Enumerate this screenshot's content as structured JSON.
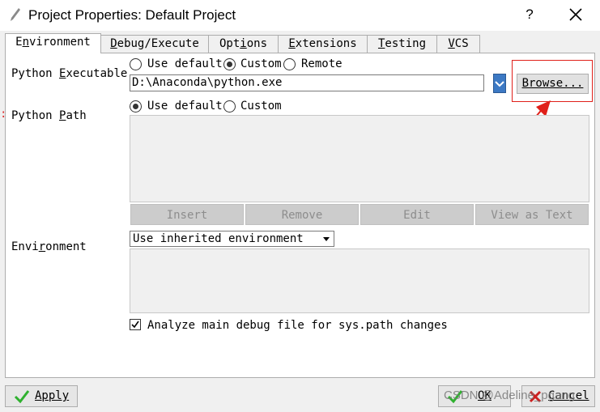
{
  "window": {
    "title": "Project Properties: Default Project",
    "help_label": "?",
    "close_icon": "close-icon",
    "title_icon": "pencil-icon"
  },
  "tabs": [
    {
      "label_pre": "E",
      "label_u": "n",
      "label_post": "vironment",
      "active": true
    },
    {
      "label_pre": "",
      "label_u": "D",
      "label_post": "ebug/Execute",
      "active": false
    },
    {
      "label_pre": "Opt",
      "label_u": "i",
      "label_post": "ons",
      "active": false
    },
    {
      "label_pre": "",
      "label_u": "E",
      "label_post": "xtensions",
      "active": false
    },
    {
      "label_pre": "",
      "label_u": "T",
      "label_post": "esting",
      "active": false
    },
    {
      "label_pre": "",
      "label_u": "V",
      "label_post": "CS",
      "active": false
    }
  ],
  "python_executable": {
    "label_pre": "Python ",
    "label_u": "E",
    "label_post": "xecutable",
    "options": [
      "Use default",
      "Custom",
      "Remote"
    ],
    "selected": "Custom",
    "value": "D:\\Anaconda\\python.exe",
    "browse_label": "Browse..."
  },
  "python_path": {
    "label_pre": "Python ",
    "label_u": "P",
    "label_post": "ath",
    "options": [
      "Use default",
      "Custom"
    ],
    "selected": "Use default",
    "buttons": [
      "Insert",
      "Remove",
      "Edit",
      "View as Text"
    ]
  },
  "environment": {
    "label_pre": "Envi",
    "label_u": "r",
    "label_post": "onment",
    "select_value": "Use inherited environment"
  },
  "analyze_checkbox": {
    "checked": true,
    "label": "Analyze main debug file for sys.path changes"
  },
  "footer": {
    "apply_label": "Apply",
    "ok_label": "OK",
    "cancel_label": "Cancel"
  },
  "watermark": "CSDN @Adeline_pgang",
  "colors": {
    "annotation_red": "#e0201a",
    "check_green": "#2fb12f",
    "cancel_red": "#cc1f1f",
    "dropdown_blue": "#3c79c4"
  }
}
